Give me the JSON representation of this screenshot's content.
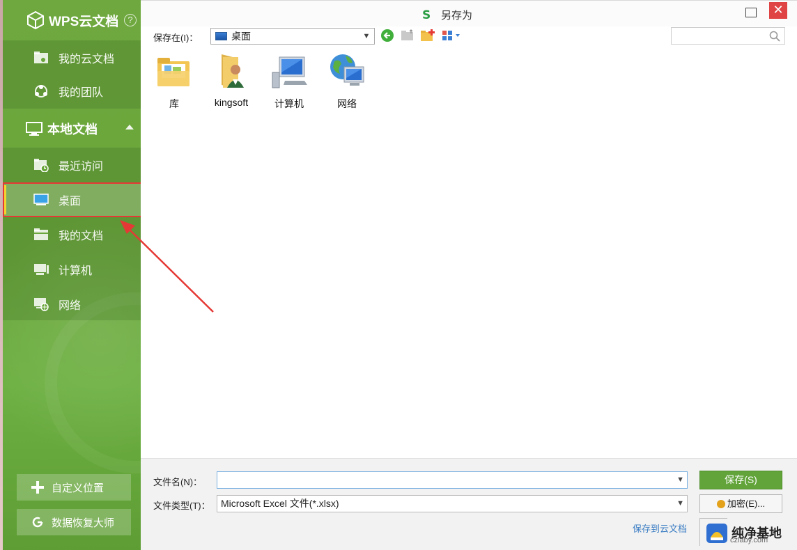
{
  "sidebar": {
    "cloud_title": "WPS云文档",
    "help_icon": "?",
    "cloud_items": [
      {
        "label": "我的云文档",
        "icon": "cloud-folder-icon"
      },
      {
        "label": "我的团队",
        "icon": "team-icon"
      }
    ],
    "local_title": "本地文档",
    "local_items": [
      {
        "label": "最近访问",
        "icon": "recent-folder-icon"
      },
      {
        "label": "桌面",
        "icon": "desktop-icon",
        "selected": true
      },
      {
        "label": "我的文档",
        "icon": "documents-folder-icon"
      },
      {
        "label": "计算机",
        "icon": "computer-icon"
      },
      {
        "label": "网络",
        "icon": "network-icon"
      }
    ],
    "buttons": [
      {
        "label": "自定义位置",
        "icon": "plus-icon"
      },
      {
        "label": "数据恢复大师",
        "icon": "recovery-icon"
      }
    ]
  },
  "dialog": {
    "title": "另存为",
    "app_logo": "S",
    "close_glyph": "✕",
    "save_in_label": "保存在(I)：",
    "location": "桌面",
    "search_placeholder": ""
  },
  "files": [
    {
      "name": "库",
      "icon": "library-folder-icon"
    },
    {
      "name": "kingsoft",
      "icon": "user-folder-icon"
    },
    {
      "name": "计算机",
      "icon": "computer-icon"
    },
    {
      "name": "网络",
      "icon": "network-globe-icon"
    }
  ],
  "form": {
    "filename_label": "文件名(N)：",
    "filename_value": "",
    "filetype_label": "文件类型(T)：",
    "filetype_value": "Microsoft Excel 文件(*.xlsx)",
    "save_button": "保存(S)",
    "encrypt_button": "加密(E)...",
    "save_to_cloud": "保存到云文档"
  },
  "watermark": {
    "title": "纯净基地",
    "subtitle": "czlaby.com"
  },
  "colors": {
    "sidebar_green": "#6aa63b",
    "save_green": "#62a43a",
    "highlight_red": "#e53935",
    "close_red": "#e04343"
  }
}
